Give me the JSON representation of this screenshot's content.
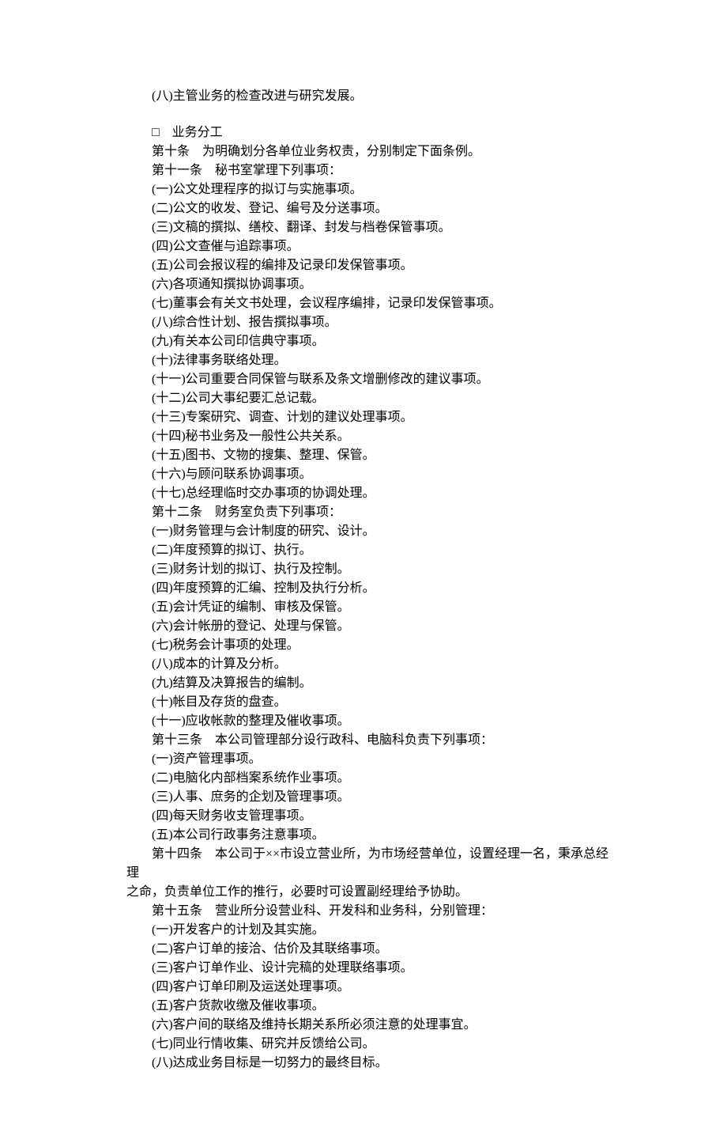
{
  "lines": [
    {
      "text": "(八)主管业务的检查改进与研究发展。",
      "indent": 1
    },
    {
      "blank": true
    },
    {
      "text": "□　业务分工",
      "indent": 1
    },
    {
      "text": "第十条　为明确划分各单位业务权责，分别制定下面条例。",
      "indent": 1
    },
    {
      "text": "第十一条　秘书室掌理下列事项：",
      "indent": 1
    },
    {
      "text": "(一)公文处理程序的拟订与实施事项。",
      "indent": 1
    },
    {
      "text": "(二)公文的收发、登记、编号及分送事项。",
      "indent": 1
    },
    {
      "text": "(三)文稿的撰拟、缮校、翻译、封发与档卷保管事项。",
      "indent": 1
    },
    {
      "text": "(四)公文查催与追踪事项。",
      "indent": 1
    },
    {
      "text": "(五)公司会报议程的编排及记录印发保管事项。",
      "indent": 1
    },
    {
      "text": "(六)各项通知撰拟协调事项。",
      "indent": 1
    },
    {
      "text": "(七)董事会有关文书处理，会议程序编排，记录印发保管事项。",
      "indent": 1
    },
    {
      "text": "(八)综合性计划、报告撰拟事项。",
      "indent": 1
    },
    {
      "text": "(九)有关本公司印信典守事项。",
      "indent": 1
    },
    {
      "text": "(十)法律事务联络处理。",
      "indent": 1
    },
    {
      "text": "(十一)公司重要合同保管与联系及条文增删修改的建议事项。",
      "indent": 1
    },
    {
      "text": "(十二)公司大事纪要汇总记载。",
      "indent": 1
    },
    {
      "text": "(十三)专案研究、调查、计划的建议处理事项。",
      "indent": 1
    },
    {
      "text": "(十四)秘书业务及一般性公共关系。",
      "indent": 1
    },
    {
      "text": "(十五)图书、文物的搜集、整理、保管。",
      "indent": 1
    },
    {
      "text": "(十六)与顾问联系协调事项。",
      "indent": 1
    },
    {
      "text": "(十七)总经理临时交办事项的协调处理。",
      "indent": 1
    },
    {
      "text": "第十二条　财务室负责下列事项：",
      "indent": 1
    },
    {
      "text": "(一)财务管理与会计制度的研究、设计。",
      "indent": 1
    },
    {
      "text": "(二)年度预算的拟订、执行。",
      "indent": 1
    },
    {
      "text": "(三)财务计划的拟订、执行及控制。",
      "indent": 1
    },
    {
      "text": "(四)年度预算的汇编、控制及执行分析。",
      "indent": 1
    },
    {
      "text": "(五)会计凭证的编制、审核及保管。",
      "indent": 1
    },
    {
      "text": "(六)会计帐册的登记、处理与保管。",
      "indent": 1
    },
    {
      "text": "(七)税务会计事项的处理。",
      "indent": 1
    },
    {
      "text": "(八)成本的计算及分析。",
      "indent": 1
    },
    {
      "text": "(九)结算及决算报告的编制。",
      "indent": 1
    },
    {
      "text": "(十)帐目及存货的盘查。",
      "indent": 1
    },
    {
      "text": "(十一)应收帐款的整理及催收事项。",
      "indent": 1
    },
    {
      "text": "第十三条　本公司管理部分设行政科、电脑科负责下列事项：",
      "indent": 1
    },
    {
      "text": "(一)资产管理事项。",
      "indent": 1
    },
    {
      "text": "(二)电脑化内部档案系统作业事项。",
      "indent": 1
    },
    {
      "text": "(三)人事、庶务的企划及管理事项。",
      "indent": 1
    },
    {
      "text": "(四)每天财务收支管理事项。",
      "indent": 1
    },
    {
      "text": "(五)本公司行政事务注意事项。",
      "indent": 1
    },
    {
      "text": "第十四条　本公司于××市设立营业所，为市场经营单位，设置经理一名，秉承总经理",
      "indent": 1
    },
    {
      "text": "之命，负责单位工作的推行，必要时可设置副经理给予协助。",
      "indent": 0,
      "wrap": true
    },
    {
      "text": "第十五条　营业所分设营业科、开发科和业务科，分别管理：",
      "indent": 1
    },
    {
      "text": "(一)开发客户的计划及其实施。",
      "indent": 1
    },
    {
      "text": "(二)客户订单的接洽、估价及其联络事项。",
      "indent": 1
    },
    {
      "text": "(三)客户订单作业、设计完稿的处理联络事项。",
      "indent": 1
    },
    {
      "text": "(四)客户订单印刷及运送处理事项。",
      "indent": 1
    },
    {
      "text": "(五)客户货款收缴及催收事项。",
      "indent": 1
    },
    {
      "text": "(六)客户间的联络及维持长期关系所必须注意的处理事宜。",
      "indent": 1
    },
    {
      "text": "(七)同业行情收集、研究并反馈给公司。",
      "indent": 1
    },
    {
      "text": "(八)达成业务目标是一切努力的最终目标。",
      "indent": 1
    }
  ]
}
